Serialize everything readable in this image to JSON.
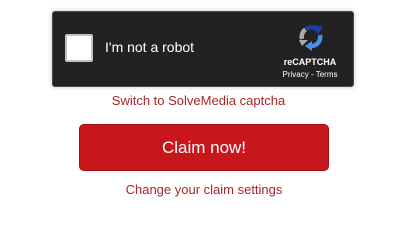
{
  "recaptcha": {
    "label": "I'm not a robot",
    "brand": "reCAPTCHA",
    "privacy_label": "Privacy",
    "separator": " - ",
    "terms_label": "Terms",
    "logo_icon": "recaptcha-logo-icon"
  },
  "switch_link": {
    "label": "Switch to SolveMedia captcha"
  },
  "claim_button": {
    "label": "Claim now!"
  },
  "settings_link": {
    "label": "Change your claim settings"
  },
  "colors": {
    "widget_bg": "#222222",
    "link": "#a8262a",
    "button": "#c8161d",
    "logo_blue_dark": "#1c3aa9",
    "logo_blue_light": "#4a90e2",
    "logo_gray": "#ababab"
  }
}
